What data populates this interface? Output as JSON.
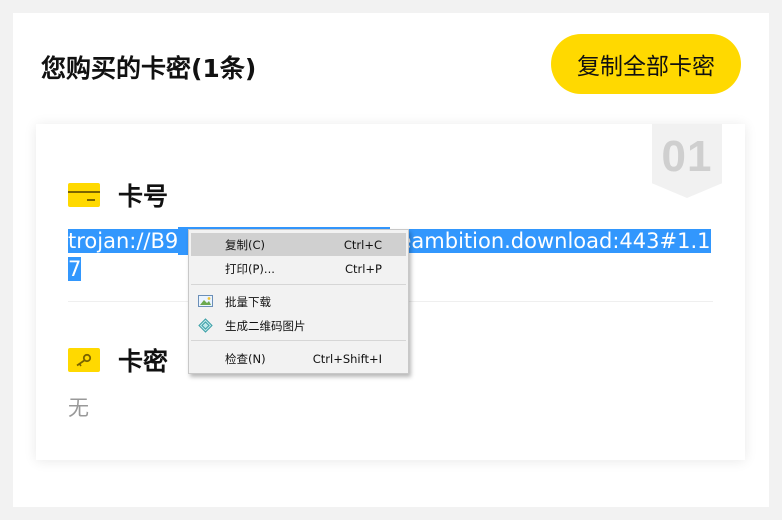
{
  "header": {
    "title": "您购买的卡密(1条)",
    "copy_all_label": "复制全部卡密"
  },
  "card": {
    "index": "01",
    "number_section": {
      "label": "卡号",
      "value_visible_start": "trojan://B9",
      "value_visible_end": "teambition.download:443#1.17"
    },
    "password_section": {
      "label": "卡密",
      "value": "无"
    }
  },
  "context_menu": {
    "items": [
      {
        "label": "复制(C)",
        "shortcut": "Ctrl+C",
        "highlighted": true
      },
      {
        "label": "打印(P)...",
        "shortcut": "Ctrl+P"
      },
      {
        "label": "批量下载",
        "shortcut": "",
        "icon": "image-download-icon"
      },
      {
        "label": "生成二维码图片",
        "shortcut": "",
        "icon": "qrcode-icon"
      },
      {
        "label": "检查(N)",
        "shortcut": "Ctrl+Shift+I"
      }
    ]
  },
  "colors": {
    "accent_yellow": "#ffd900",
    "selection_blue": "#3297fd",
    "page_bg": "#f2f2f2"
  }
}
